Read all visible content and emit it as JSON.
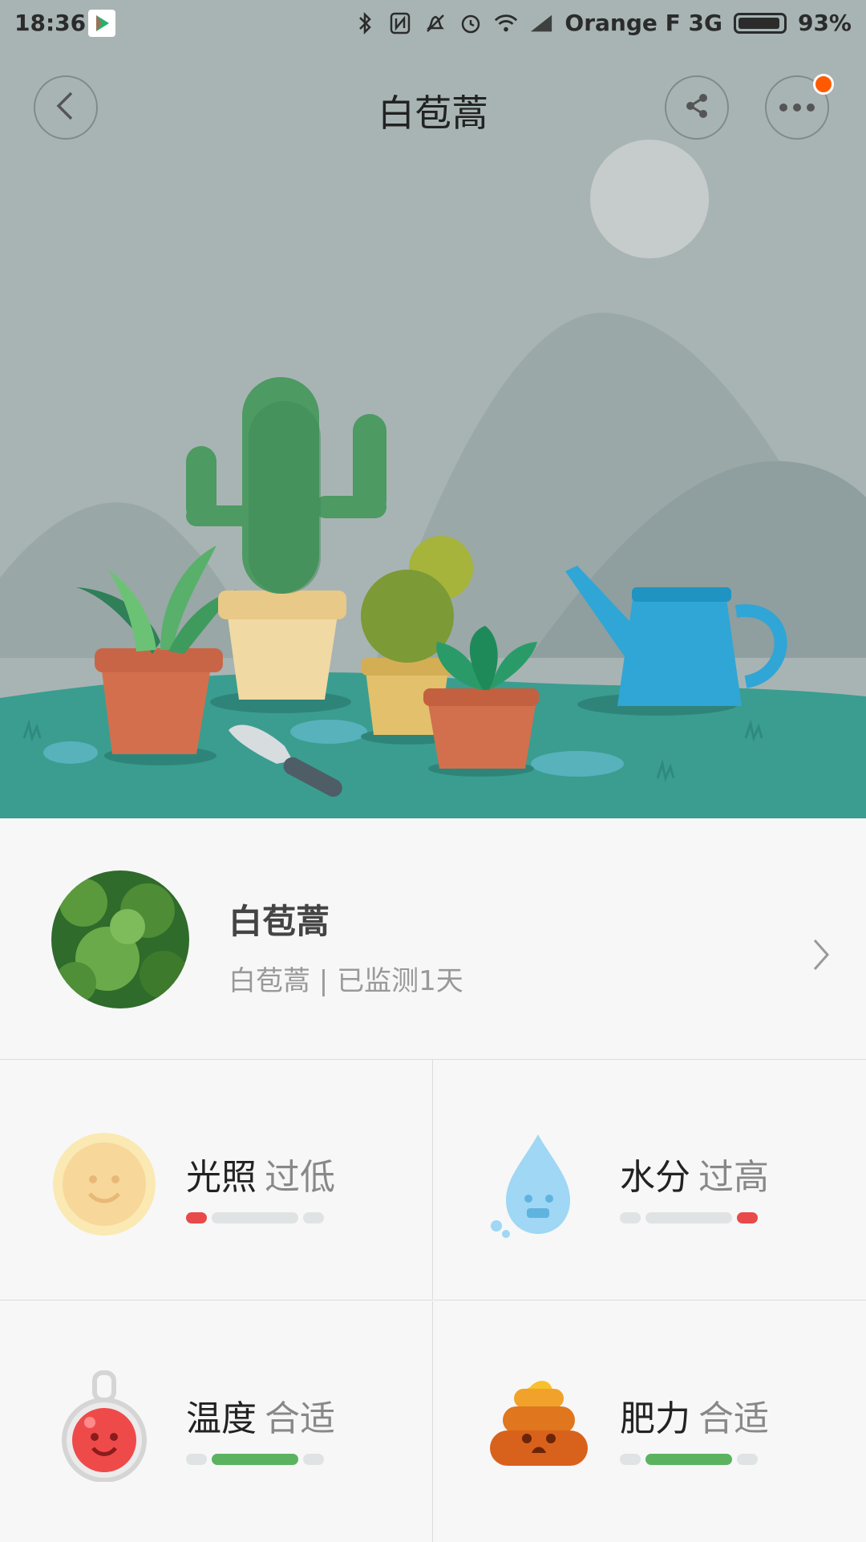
{
  "status_bar": {
    "time": "18:36",
    "carrier": "Orange F 3G",
    "battery": "93%",
    "icons": [
      "play-store-icon",
      "bluetooth-icon",
      "nfc-icon",
      "mute-icon",
      "alarm-icon",
      "wifi-icon",
      "signal-icon",
      "battery-icon"
    ]
  },
  "header": {
    "title": "白苞蒿",
    "back_icon": "back-chevron-icon",
    "share_icon": "share-icon",
    "more_icon": "more-icon"
  },
  "plant": {
    "name": "白苞蒿",
    "subtitle": "白苞蒿 | 已监测1天"
  },
  "metrics": [
    {
      "label": "光照",
      "status": "过低",
      "icon": "sun-icon",
      "level": "low",
      "indicator_color": "#e84a4a"
    },
    {
      "label": "水分",
      "status": "过高",
      "icon": "water-drop-icon",
      "level": "high",
      "indicator_color": "#e84a4a"
    },
    {
      "label": "温度",
      "status": "合适",
      "icon": "thermometer-icon",
      "level": "ok",
      "indicator_color": "#5bb35f"
    },
    {
      "label": "肥力",
      "status": "合适",
      "icon": "fertilizer-icon",
      "level": "ok",
      "indicator_color": "#5bb35f"
    }
  ],
  "colors": {
    "sky": "#a8b4b4",
    "ground": "#3a9d90",
    "alert": "#e84a4a",
    "ok": "#5bb35f",
    "notification": "#ff5a00"
  }
}
